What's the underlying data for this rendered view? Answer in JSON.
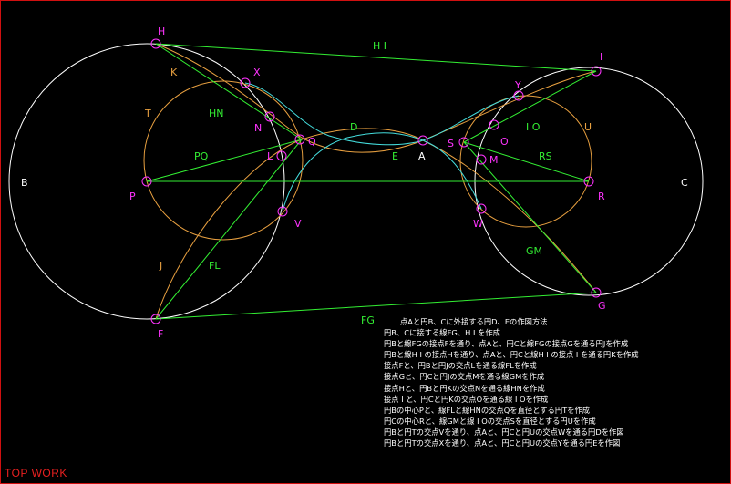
{
  "labels": {
    "points": {
      "H": "H",
      "I": "I",
      "K": "K",
      "X": "X",
      "Y": "Y",
      "N": "N",
      "Q": "Q",
      "D": "D",
      "A": "A",
      "S": "S",
      "O": "O",
      "L": "L",
      "M": "M",
      "P": "P",
      "R": "R",
      "V": "V",
      "W": "W",
      "F": "F",
      "G": "G"
    },
    "lines": {
      "HI": "H I",
      "HN": "HN",
      "IO": "I O",
      "PQ": "PQ",
      "RS": "RS",
      "GM": "GM",
      "FL": "FL",
      "FG": "FG"
    },
    "circles": {
      "B": "B",
      "C": "C",
      "T": "T",
      "U": "U",
      "J": "J",
      "E": "E"
    }
  },
  "steps": [
    "点Aと円B、Cに外接する円D、Eの作図方法",
    "円B、Cに接する線FG、H I を作成",
    "円Bと線FGの接点Fを通り、点Aと、円Cと線FGの接点Gを通る円Jを作成",
    "円Bと線H I の接点Hを通り、点Aと、円Cと線H I の接点 I を通る円Kを作成",
    "接点Fと、円Bと円Jの交点Lを通る線FLを作成",
    "接点Gと、円Cと円Jの交点Mを通る線GMを作成",
    "接点Hと、円Bと円Kの交点Nを通る線HNを作成",
    "接点 I と、円Cと円Kの交点Oを通る線 I Oを作成",
    "円Bの中心Pと、線FLと線HNの交点Qを直径とする円Tを作成",
    "円Cの中心Rと、線GMと線 I Oの交点Sを直径とする円Uを作成",
    "円Bと円Tの交点Vを通り、点Aと、円Cと円Uの交点Wを通る円Dを作図",
    "円Bと円Tの交点Xを通り、点Aと、円Cと円Uの交点Yを通る円Eを作図"
  ],
  "footer": "TOP WORK",
  "colors": {
    "background": "#000000",
    "frame": "#d01010",
    "circle_main": "#ffffff",
    "circle_aux": "#e8a040",
    "circle_tangent": "#44dddd",
    "lines": "#33ee33",
    "points": "#ff33ff",
    "footer": "#e82020"
  }
}
